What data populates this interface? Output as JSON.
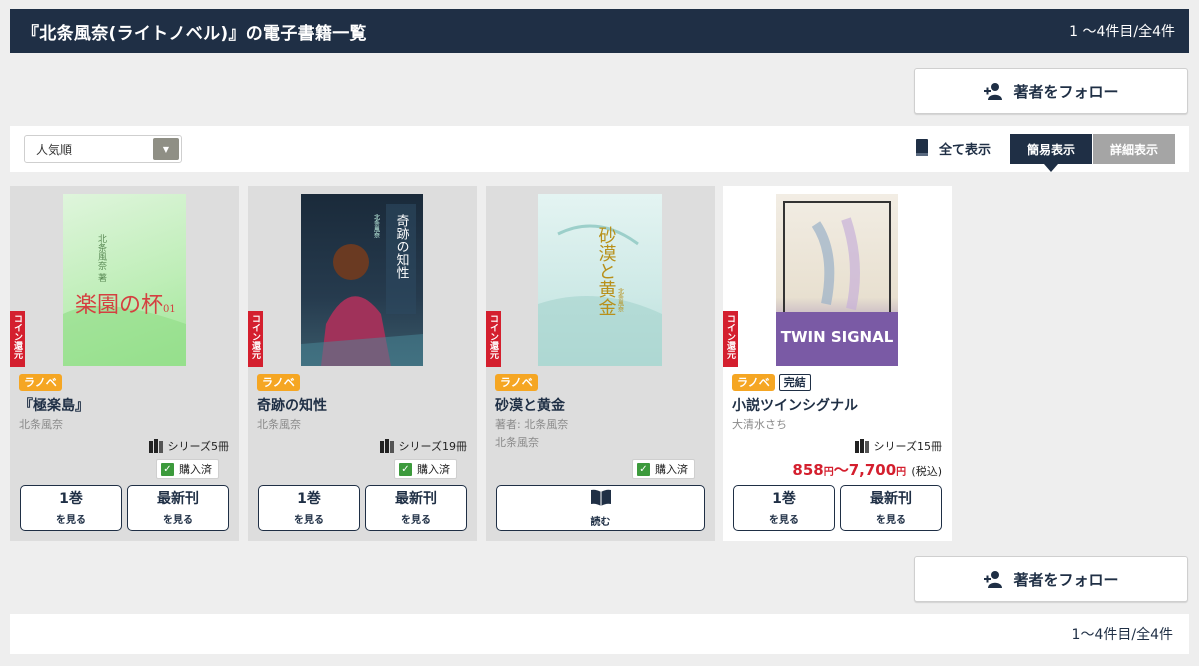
{
  "header": {
    "title": "『北条風奈(ライトノベル)』の電子書籍一覧",
    "count": "1 〜4件目/全4件"
  },
  "follow": {
    "label": "著者をフォロー"
  },
  "toolbar": {
    "sort_selected": "人気順",
    "show_all": "全て表示",
    "view_simple": "簡易表示",
    "view_detail": "詳細表示"
  },
  "books": [
    {
      "coin": "コイン還元",
      "badge": "ラノベ",
      "title": "『極楽島』",
      "author": "北条風奈",
      "series": "シリーズ5冊",
      "purchased": "購入済",
      "first_l1": "1巻",
      "first_l2": "を見る",
      "latest_l1": "最新刊",
      "latest_l2": "を見る"
    },
    {
      "coin": "コイン還元",
      "badge": "ラノベ",
      "title": "奇跡の知性",
      "author": "北条風奈",
      "series": "シリーズ19冊",
      "purchased": "購入済",
      "first_l1": "1巻",
      "first_l2": "を見る",
      "latest_l1": "最新刊",
      "latest_l2": "を見る"
    },
    {
      "coin": "コイン還元",
      "badge": "ラノベ",
      "title": "砂漠と黄金",
      "author_line": "著者: 北条風奈",
      "author": "北条風奈",
      "purchased": "購入済",
      "read": "読む"
    },
    {
      "coin": "コイン還元",
      "badge": "ラノベ",
      "badge2": "完結",
      "title": "小説ツインシグナル",
      "author": "大清水さち",
      "series": "シリーズ15冊",
      "price_low": "858",
      "price_high": "〜7,700",
      "yen": "円",
      "tax": "(税込)",
      "first_l1": "1巻",
      "first_l2": "を見る",
      "latest_l1": "最新刊",
      "latest_l2": "を見る"
    }
  ],
  "covers": [
    {
      "text_vertical": "北条風奈 著",
      "text_main": "楽園の杯",
      "text_sub": "01"
    },
    {
      "text_vertical": "北条風奈",
      "text_main": "奇跡の知性"
    },
    {
      "text_main": "砂漠と黄金",
      "text_vertical": "北条風奈"
    },
    {
      "text_main": "TWIN SIGNAL"
    }
  ],
  "footer": {
    "count": "1〜4件目/全4件"
  },
  "colors": {
    "navy": "#1f2f45",
    "red": "#d41f2e",
    "orange": "#f5a623",
    "green": "#3c9a3c"
  }
}
